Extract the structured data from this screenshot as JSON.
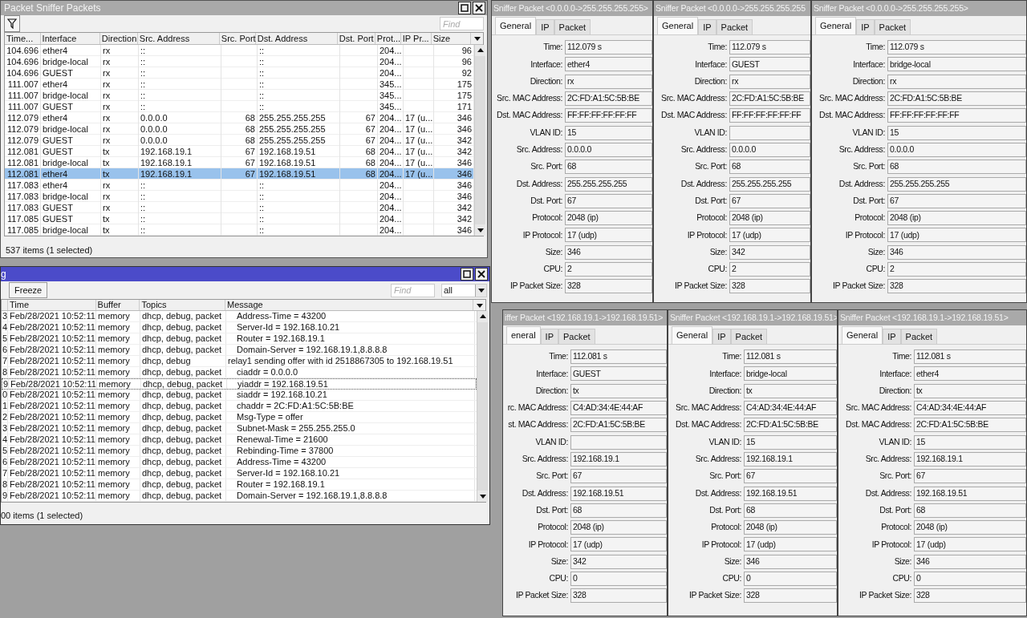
{
  "packet_sniffer": {
    "title": "Packet Sniffer Packets",
    "find_placeholder": "Find",
    "columns": [
      "Time...",
      "Interface",
      "Direction",
      "Src. Address",
      "Src. Port",
      "Dst. Address",
      "Dst. Port",
      "Prot...",
      "IP Pr...",
      "Size"
    ],
    "rows": [
      {
        "cells": [
          "104.696",
          "ether4",
          "rx",
          "::",
          "",
          "::",
          "",
          "204...",
          "",
          "96"
        ],
        "selected": false
      },
      {
        "cells": [
          "104.696",
          "bridge-local",
          "rx",
          "::",
          "",
          "::",
          "",
          "204...",
          "",
          "96"
        ],
        "selected": false
      },
      {
        "cells": [
          "104.696",
          "GUEST",
          "rx",
          "::",
          "",
          "::",
          "",
          "204...",
          "",
          "92"
        ],
        "selected": false
      },
      {
        "cells": [
          "111.007",
          "ether4",
          "rx",
          "::",
          "",
          "::",
          "",
          "345...",
          "",
          "175"
        ],
        "selected": false
      },
      {
        "cells": [
          "111.007",
          "bridge-local",
          "rx",
          "::",
          "",
          "::",
          "",
          "345...",
          "",
          "175"
        ],
        "selected": false
      },
      {
        "cells": [
          "111.007",
          "GUEST",
          "rx",
          "::",
          "",
          "::",
          "",
          "345...",
          "",
          "171"
        ],
        "selected": false
      },
      {
        "cells": [
          "112.079",
          "ether4",
          "rx",
          "0.0.0.0",
          "68",
          "255.255.255.255",
          "67",
          "204...",
          "17 (u...",
          "346"
        ],
        "selected": false
      },
      {
        "cells": [
          "112.079",
          "bridge-local",
          "rx",
          "0.0.0.0",
          "68",
          "255.255.255.255",
          "67",
          "204...",
          "17 (u...",
          "346"
        ],
        "selected": false
      },
      {
        "cells": [
          "112.079",
          "GUEST",
          "rx",
          "0.0.0.0",
          "68",
          "255.255.255.255",
          "67",
          "204...",
          "17 (u...",
          "342"
        ],
        "selected": false
      },
      {
        "cells": [
          "112.081",
          "GUEST",
          "tx",
          "192.168.19.1",
          "67",
          "192.168.19.51",
          "68",
          "204...",
          "17 (u...",
          "342"
        ],
        "selected": false
      },
      {
        "cells": [
          "112.081",
          "bridge-local",
          "tx",
          "192.168.19.1",
          "67",
          "192.168.19.51",
          "68",
          "204...",
          "17 (u...",
          "346"
        ],
        "selected": false
      },
      {
        "cells": [
          "112.081",
          "ether4",
          "tx",
          "192.168.19.1",
          "67",
          "192.168.19.51",
          "68",
          "204...",
          "17 (u...",
          "346"
        ],
        "selected": true
      },
      {
        "cells": [
          "117.083",
          "ether4",
          "rx",
          "::",
          "",
          "::",
          "",
          "204...",
          "",
          "346"
        ],
        "selected": false
      },
      {
        "cells": [
          "117.083",
          "bridge-local",
          "rx",
          "::",
          "",
          "::",
          "",
          "204...",
          "",
          "346"
        ],
        "selected": false
      },
      {
        "cells": [
          "117.083",
          "GUEST",
          "rx",
          "::",
          "",
          "::",
          "",
          "204...",
          "",
          "342"
        ],
        "selected": false
      },
      {
        "cells": [
          "117.085",
          "GUEST",
          "tx",
          "::",
          "",
          "::",
          "",
          "204...",
          "",
          "342"
        ],
        "selected": false
      },
      {
        "cells": [
          "117.085",
          "bridge-local",
          "tx",
          "::",
          "",
          "::",
          "",
          "204...",
          "",
          "346"
        ],
        "selected": false
      }
    ],
    "status": "537 items (1 selected)"
  },
  "log": {
    "title": "g",
    "freeze_button": "Freeze",
    "find_placeholder": "Find",
    "topic_filter": "all",
    "columns": [
      "Time",
      "Buffer",
      "Topics",
      "Message"
    ],
    "rows": [
      {
        "number": "3",
        "time": "Feb/28/2021 10:52:11",
        "buffer": "memory",
        "topics": "dhcp, debug, packet",
        "message": "Address-Time = 43200",
        "indented": true,
        "selected": false
      },
      {
        "number": "4",
        "time": "Feb/28/2021 10:52:11",
        "buffer": "memory",
        "topics": "dhcp, debug, packet",
        "message": "Server-Id = 192.168.10.21",
        "indented": true,
        "selected": false
      },
      {
        "number": "5",
        "time": "Feb/28/2021 10:52:11",
        "buffer": "memory",
        "topics": "dhcp, debug, packet",
        "message": "Router = 192.168.19.1",
        "indented": true,
        "selected": false
      },
      {
        "number": "6",
        "time": "Feb/28/2021 10:52:11",
        "buffer": "memory",
        "topics": "dhcp, debug, packet",
        "message": "Domain-Server = 192.168.19.1,8.8.8.8",
        "indented": true,
        "selected": false
      },
      {
        "number": "7",
        "time": "Feb/28/2021 10:52:11",
        "buffer": "memory",
        "topics": "dhcp, debug",
        "message": "relay1 sending offer with id 2518867305 to 192.168.19.51",
        "indented": false,
        "selected": false
      },
      {
        "number": "8",
        "time": "Feb/28/2021 10:52:11",
        "buffer": "memory",
        "topics": "dhcp, debug, packet",
        "message": "ciaddr = 0.0.0.0",
        "indented": true,
        "selected": false
      },
      {
        "number": "9",
        "time": "Feb/28/2021 10:52:11",
        "buffer": "memory",
        "topics": "dhcp, debug, packet",
        "message": "yiaddr = 192.168.19.51",
        "indented": true,
        "selected": true
      },
      {
        "number": "0",
        "time": "Feb/28/2021 10:52:11",
        "buffer": "memory",
        "topics": "dhcp, debug, packet",
        "message": "siaddr = 192.168.10.21",
        "indented": true,
        "selected": false
      },
      {
        "number": "1",
        "time": "Feb/28/2021 10:52:11",
        "buffer": "memory",
        "topics": "dhcp, debug, packet",
        "message": "chaddr = 2C:FD:A1:5C:5B:BE",
        "indented": true,
        "selected": false
      },
      {
        "number": "2",
        "time": "Feb/28/2021 10:52:11",
        "buffer": "memory",
        "topics": "dhcp, debug, packet",
        "message": "Msg-Type = offer",
        "indented": true,
        "selected": false
      },
      {
        "number": "3",
        "time": "Feb/28/2021 10:52:11",
        "buffer": "memory",
        "topics": "dhcp, debug, packet",
        "message": "Subnet-Mask = 255.255.255.0",
        "indented": true,
        "selected": false
      },
      {
        "number": "4",
        "time": "Feb/28/2021 10:52:11",
        "buffer": "memory",
        "topics": "dhcp, debug, packet",
        "message": "Renewal-Time = 21600",
        "indented": true,
        "selected": false
      },
      {
        "number": "5",
        "time": "Feb/28/2021 10:52:11",
        "buffer": "memory",
        "topics": "dhcp, debug, packet",
        "message": "Rebinding-Time = 37800",
        "indented": true,
        "selected": false
      },
      {
        "number": "6",
        "time": "Feb/28/2021 10:52:11",
        "buffer": "memory",
        "topics": "dhcp, debug, packet",
        "message": "Address-Time = 43200",
        "indented": true,
        "selected": false
      },
      {
        "number": "7",
        "time": "Feb/28/2021 10:52:11",
        "buffer": "memory",
        "topics": "dhcp, debug, packet",
        "message": "Server-Id = 192.168.10.21",
        "indented": true,
        "selected": false
      },
      {
        "number": "8",
        "time": "Feb/28/2021 10:52:11",
        "buffer": "memory",
        "topics": "dhcp, debug, packet",
        "message": "Router = 192.168.19.1",
        "indented": true,
        "selected": false
      },
      {
        "number": "9",
        "time": "Feb/28/2021 10:52:11",
        "buffer": "memory",
        "topics": "dhcp, debug, packet",
        "message": "Domain-Server = 192.168.19.1,8.8.8.8",
        "indented": true,
        "selected": false
      }
    ],
    "status": "00 items (1 selected)"
  },
  "sniffer_packets": [
    {
      "title": "Sniffer Packet <0.0.0.0->255.255.255.255>",
      "tabs": [
        {
          "label": "General",
          "selected": true
        },
        {
          "label": "IP",
          "selected": false
        },
        {
          "label": "Packet",
          "selected": false
        }
      ],
      "fields": [
        {
          "label": "Time:",
          "value": "112.079 s"
        },
        {
          "label": "Interface:",
          "value": "ether4"
        },
        {
          "label": "Direction:",
          "value": "rx"
        },
        {
          "label": "Src. MAC Address:",
          "value": "2C:FD:A1:5C:5B:BE"
        },
        {
          "label": "Dst. MAC Address:",
          "value": "FF:FF:FF:FF:FF:FF"
        },
        {
          "label": "VLAN ID:",
          "value": "15"
        },
        {
          "label": "Src. Address:",
          "value": "0.0.0.0"
        },
        {
          "label": "Src. Port:",
          "value": "68"
        },
        {
          "label": "Dst. Address:",
          "value": "255.255.255.255"
        },
        {
          "label": "Dst. Port:",
          "value": "67"
        },
        {
          "label": "Protocol:",
          "value": "2048 (ip)"
        },
        {
          "label": "IP Protocol:",
          "value": "17 (udp)"
        },
        {
          "label": "Size:",
          "value": "346"
        },
        {
          "label": "CPU:",
          "value": "2"
        },
        {
          "label": "IP Packet Size:",
          "value": "328"
        }
      ]
    },
    {
      "title": "Sniffer Packet <0.0.0.0->255.255.255.255",
      "tabs": [
        {
          "label": "General",
          "selected": true
        },
        {
          "label": "IP",
          "selected": false
        },
        {
          "label": "Packet",
          "selected": false
        }
      ],
      "fields": [
        {
          "label": "Time:",
          "value": "112.079 s"
        },
        {
          "label": "Interface:",
          "value": "GUEST"
        },
        {
          "label": "Direction:",
          "value": "rx"
        },
        {
          "label": "Src. MAC Address:",
          "value": "2C:FD:A1:5C:5B:BE"
        },
        {
          "label": "Dst. MAC Address:",
          "value": "FF:FF:FF:FF:FF:FF"
        },
        {
          "label": "VLAN ID:"
        },
        {
          "label": "Src. Address:",
          "value": "0.0.0.0"
        },
        {
          "label": "Src. Port:",
          "value": "68"
        },
        {
          "label": "Dst. Address:",
          "value": "255.255.255.255"
        },
        {
          "label": "Dst. Port:",
          "value": "67"
        },
        {
          "label": "Protocol:",
          "value": "2048 (ip)"
        },
        {
          "label": "IP Protocol:",
          "value": "17 (udp)"
        },
        {
          "label": "Size:",
          "value": "342"
        },
        {
          "label": "CPU:",
          "value": "2"
        },
        {
          "label": "IP Packet Size:",
          "value": "328"
        }
      ]
    },
    {
      "title": "Sniffer Packet <0.0.0.0->255.255.255.255>",
      "tabs": [
        {
          "label": "General",
          "selected": true
        },
        {
          "label": "IP",
          "selected": false
        },
        {
          "label": "Packet",
          "selected": false
        }
      ],
      "fields": [
        {
          "label": "Time:",
          "value": "112.079 s"
        },
        {
          "label": "Interface:",
          "value": "bridge-local"
        },
        {
          "label": "Direction:",
          "value": "rx"
        },
        {
          "label": "Src. MAC Address:",
          "value": "2C:FD:A1:5C:5B:BE"
        },
        {
          "label": "Dst. MAC Address:",
          "value": "FF:FF:FF:FF:FF:FF"
        },
        {
          "label": "VLAN ID:",
          "value": "15"
        },
        {
          "label": "Src. Address:",
          "value": "0.0.0.0"
        },
        {
          "label": "Src. Port:",
          "value": "68"
        },
        {
          "label": "Dst. Address:",
          "value": "255.255.255.255"
        },
        {
          "label": "Dst. Port:",
          "value": "67"
        },
        {
          "label": "Protocol:",
          "value": "2048 (ip)"
        },
        {
          "label": "IP Protocol:",
          "value": "17 (udp)"
        },
        {
          "label": "Size:",
          "value": "346"
        },
        {
          "label": "CPU:",
          "value": "2"
        },
        {
          "label": "IP Packet Size:",
          "value": "328"
        }
      ]
    },
    {
      "title": "iffer Packet <192.168.19.1->192.168.19.51>",
      "tabs": [
        {
          "label": "eneral",
          "selected": true
        },
        {
          "label": "IP",
          "selected": false
        },
        {
          "label": "Packet",
          "selected": false
        }
      ],
      "fields": [
        {
          "label": "Time:",
          "value": "112.081 s"
        },
        {
          "label": "Interface:",
          "value": "GUEST"
        },
        {
          "label": "Direction:",
          "value": "tx"
        },
        {
          "label": "rc. MAC Address:",
          "value": "C4:AD:34:4E:44:AF"
        },
        {
          "label": "st. MAC Address:",
          "value": "2C:FD:A1:5C:5B:BE"
        },
        {
          "label": "VLAN ID:"
        },
        {
          "label": "Src. Address:",
          "value": "192.168.19.1"
        },
        {
          "label": "Src. Port:",
          "value": "67"
        },
        {
          "label": "Dst. Address:",
          "value": "192.168.19.51"
        },
        {
          "label": "Dst. Port:",
          "value": "68"
        },
        {
          "label": "Protocol:",
          "value": "2048 (ip)"
        },
        {
          "label": "IP Protocol:",
          "value": "17 (udp)"
        },
        {
          "label": "Size:",
          "value": "342"
        },
        {
          "label": "CPU:",
          "value": "0"
        },
        {
          "label": "IP Packet Size:",
          "value": "328"
        }
      ]
    },
    {
      "title": "Sniffer Packet <192.168.19.1->192.168.19.51>",
      "tabs": [
        {
          "label": "General",
          "selected": true
        },
        {
          "label": "IP",
          "selected": false
        },
        {
          "label": "Packet",
          "selected": false
        }
      ],
      "fields": [
        {
          "label": "Time:",
          "value": "112.081 s"
        },
        {
          "label": "Interface:",
          "value": "bridge-local"
        },
        {
          "label": "Direction:",
          "value": "tx"
        },
        {
          "label": "Src. MAC Address:",
          "value": "C4:AD:34:4E:44:AF"
        },
        {
          "label": "Dst. MAC Address:",
          "value": "2C:FD:A1:5C:5B:BE"
        },
        {
          "label": "VLAN ID:",
          "value": "15"
        },
        {
          "label": "Src. Address:",
          "value": "192.168.19.1"
        },
        {
          "label": "Src. Port:",
          "value": "67"
        },
        {
          "label": "Dst. Address:",
          "value": "192.168.19.51"
        },
        {
          "label": "Dst. Port:",
          "value": "68"
        },
        {
          "label": "Protocol:",
          "value": "2048 (ip)"
        },
        {
          "label": "IP Protocol:",
          "value": "17 (udp)"
        },
        {
          "label": "Size:",
          "value": "346"
        },
        {
          "label": "CPU:",
          "value": "0"
        },
        {
          "label": "IP Packet Size:",
          "value": "328"
        }
      ]
    },
    {
      "title": "Sniffer Packet <192.168.19.1->192.168.19.51>",
      "tabs": [
        {
          "label": "General",
          "selected": true
        },
        {
          "label": "IP",
          "selected": false
        },
        {
          "label": "Packet",
          "selected": false
        }
      ],
      "fields": [
        {
          "label": "Time:",
          "value": "112.081 s"
        },
        {
          "label": "Interface:",
          "value": "ether4"
        },
        {
          "label": "Direction:",
          "value": "tx"
        },
        {
          "label": "Src. MAC Address:",
          "value": "C4:AD:34:4E:44:AF"
        },
        {
          "label": "Dst. MAC Address:",
          "value": "2C:FD:A1:5C:5B:BE"
        },
        {
          "label": "VLAN ID:",
          "value": "15"
        },
        {
          "label": "Src. Address:",
          "value": "192.168.19.1"
        },
        {
          "label": "Src. Port:",
          "value": "67"
        },
        {
          "label": "Dst. Address:",
          "value": "192.168.19.51"
        },
        {
          "label": "Dst. Port:",
          "value": "68"
        },
        {
          "label": "Protocol:",
          "value": "2048 (ip)"
        },
        {
          "label": "IP Protocol:",
          "value": "17 (udp)"
        },
        {
          "label": "Size:",
          "value": "346"
        },
        {
          "label": "CPU:",
          "value": "0"
        },
        {
          "label": "IP Packet Size:",
          "value": "328"
        }
      ]
    }
  ]
}
